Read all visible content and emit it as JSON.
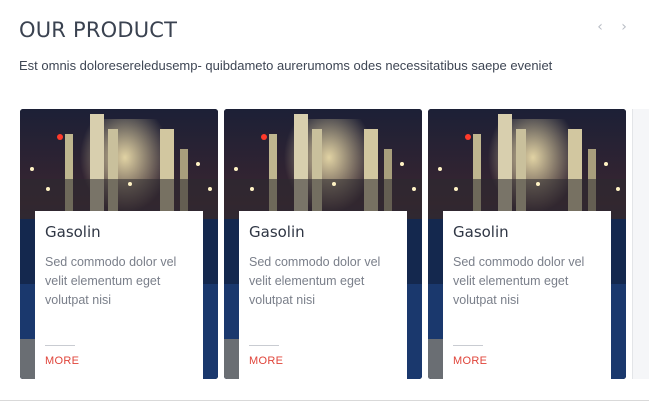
{
  "section": {
    "title": "OUR PRODUCT",
    "subtitle": "Est omnis doloresereledusemp- quibdameto aurerumoms odes necessitatibus saepe eveniet"
  },
  "nav": {
    "prev_icon": "chevron-left-icon",
    "next_icon": "chevron-right-icon",
    "prev_glyph": "‹",
    "next_glyph": "›"
  },
  "cards": [
    {
      "title": "Gasolin",
      "text": "Sed commodo dolor vel velit elementum eget volutpat nisi",
      "more": "MORE",
      "image": "refinery-night-image"
    },
    {
      "title": "Gasolin",
      "text": "Sed commodo dolor vel velit elementum eget volutpat nisi",
      "more": "MORE",
      "image": "refinery-night-image"
    },
    {
      "title": "Gasolin",
      "text": "Sed commodo dolor vel velit elementum eget volutpat nisi",
      "more": "MORE",
      "image": "refinery-night-image"
    }
  ],
  "colors": {
    "accent": "#e0443a",
    "title": "#3a4250",
    "text": "#7a7f8a"
  }
}
